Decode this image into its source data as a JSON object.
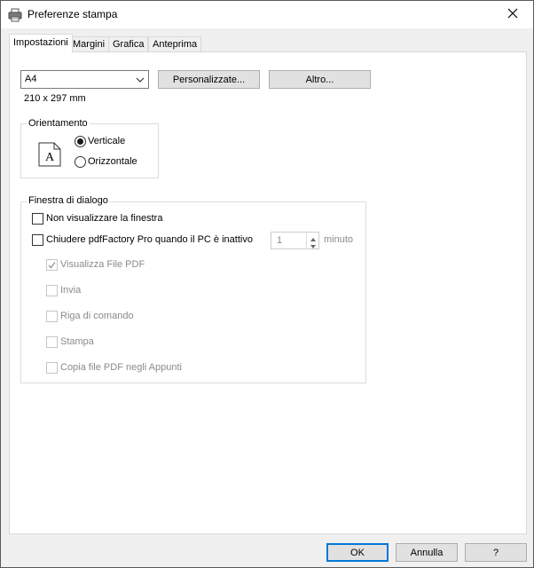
{
  "window": {
    "title": "Preferenze stampa",
    "app_icon": "printer-icon",
    "close_icon": "close-icon"
  },
  "tabs": [
    {
      "label": "Impostazioni",
      "active": true
    },
    {
      "label": "Margini",
      "active": false
    },
    {
      "label": "Grafica",
      "active": false
    },
    {
      "label": "Anteprima",
      "active": false
    }
  ],
  "paper": {
    "selected": "A4",
    "dimensions": "210 x 297 mm",
    "custom_button": "Personalizzate...",
    "custom_button_mnemonic": "P",
    "other_button": "Altro...",
    "other_button_mnemonic": "l"
  },
  "orientation": {
    "group_label": "Orientamento",
    "preview_letter": "A",
    "options": [
      {
        "label": "Verticale",
        "mnemonic": "V",
        "checked": true
      },
      {
        "label": "Orizzontale",
        "mnemonic": "O",
        "checked": false
      }
    ]
  },
  "dialog": {
    "group_label": "Finestra di dialogo",
    "dont_show": {
      "label": "Non visualizzare la finestra",
      "checked": false
    },
    "close_when_idle": {
      "label": "Chiudere pdfFactory Pro quando il PC è inattivo",
      "checked": false
    },
    "minutes_value": "1",
    "minutes_unit": "minuto",
    "sub_options": [
      {
        "label": "Visualizza File PDF",
        "checked": true,
        "disabled": true
      },
      {
        "label": "Invia",
        "checked": false,
        "disabled": true
      },
      {
        "label": "Riga di comando",
        "checked": false,
        "disabled": true
      },
      {
        "label": "Stampa",
        "checked": false,
        "disabled": true
      },
      {
        "label": "Copia file PDF negli Appunti",
        "checked": false,
        "disabled": true
      }
    ]
  },
  "buttons": {
    "ok": "OK",
    "cancel": "Annulla",
    "help": "?"
  },
  "colors": {
    "accent": "#0078d7",
    "window_bg": "#f0f0f0",
    "panel_bg": "#ffffff",
    "disabled_text": "#8a8a8a"
  }
}
